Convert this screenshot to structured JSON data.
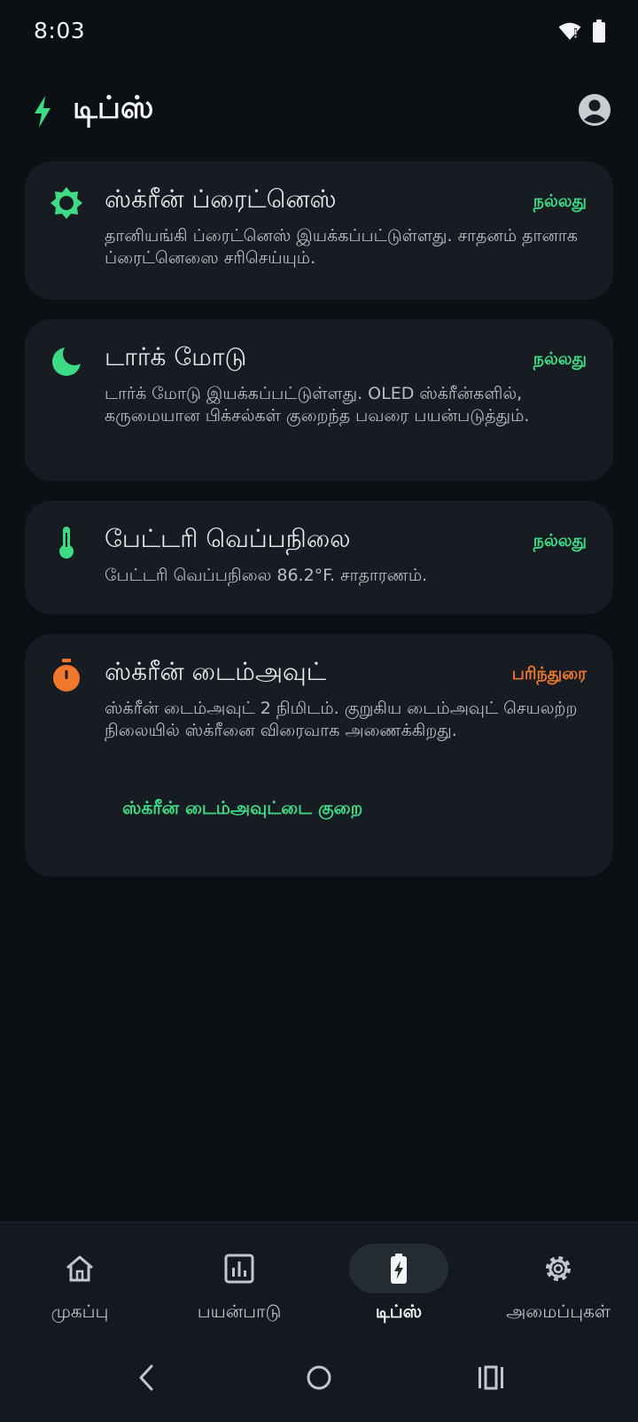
{
  "status_bar": {
    "time": "8:03",
    "icons": [
      "wifi-icon",
      "battery-icon"
    ]
  },
  "header": {
    "title": "டிப்ஸ்",
    "icon": "bolt-icon",
    "account_icon": "account-circle-icon"
  },
  "colors": {
    "good": "#3ddc84",
    "warning": "#f0772b",
    "card_bg": "#171c22",
    "page_bg": "#0c0f13"
  },
  "cards": [
    {
      "icon": "brightness-icon",
      "title": "ஸ்க்ரீன் ப்ரைட்னெஸ்",
      "status": "நல்லது",
      "description": "தானியங்கி ப்ரைட்னெஸ் இயக்கப்பட்டுள்ளது. சாதனம் தானாக ப்ரைட்னெஸை சரிசெய்யும்."
    },
    {
      "icon": "moon-icon",
      "title": "டார்க் மோடு",
      "status": "நல்லது",
      "description": "டார்க் மோடு இயக்கப்பட்டுள்ளது. OLED ஸ்க்ரீன்களில், கருமையான பிக்சல்கள் குறைந்த பவரை பயன்படுத்தும்."
    },
    {
      "icon": "thermometer-icon",
      "title": "பேட்டரி வெப்பநிலை",
      "status": "நல்லது",
      "description": "பேட்டரி வெப்பநிலை 86.2°F. சாதாரணம்."
    },
    {
      "icon": "timer-icon",
      "title": "ஸ்க்ரீன் டைம்அவுட்",
      "status": "பரிந்துரை",
      "description": "ஸ்க்ரீன் டைம்அவுட் 2 நிமிடம். குறுகிய டைம்அவுட் செயலற்ற நிலையில் ஸ்க்ரீனை விரைவாக அணைக்கிறது.",
      "action": "ஸ்க்ரீன் டைம்அவுட்டை குறை"
    }
  ],
  "bottom_nav": {
    "items": [
      {
        "label": "முகப்பு",
        "icon": "home-icon"
      },
      {
        "label": "பயன்பாடு",
        "icon": "usage-chart-icon"
      },
      {
        "label": "டிப்ஸ்",
        "icon": "battery-bolt-icon",
        "active": true
      },
      {
        "label": "அமைப்புகள்",
        "icon": "gear-icon"
      }
    ]
  },
  "system_nav": [
    "back-icon",
    "home-circle-icon",
    "recents-icon"
  ]
}
